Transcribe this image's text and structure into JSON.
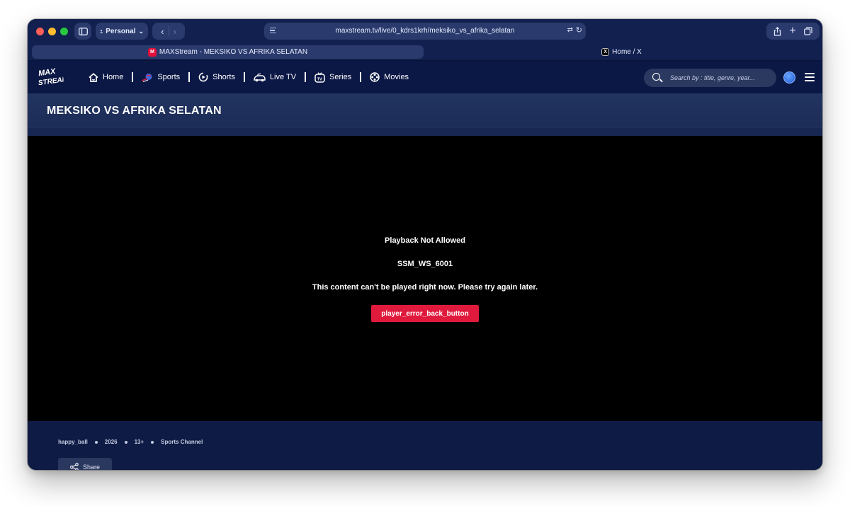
{
  "browser": {
    "profile_label": "Personal",
    "url": "maxstream.tv/live/0_kdrs1krh/meksiko_vs_afrika_selatan",
    "tabs": [
      {
        "title": "MAXStream - MEKSIKO VS AFRIKA SELATAN",
        "favicon": "maxstream-favicon",
        "active": true
      },
      {
        "title": "Home / X",
        "favicon": "x-favicon",
        "active": false
      }
    ]
  },
  "site": {
    "logo_text": "MAX STREAM",
    "nav": [
      {
        "label": "Home",
        "icon": "home-icon"
      },
      {
        "label": "Sports",
        "icon": "sports-icon"
      },
      {
        "label": "Shorts",
        "icon": "shorts-icon"
      },
      {
        "label": "Live TV",
        "icon": "live-tv-icon"
      },
      {
        "label": "Series",
        "icon": "series-icon"
      },
      {
        "label": "Movies",
        "icon": "movies-icon"
      }
    ],
    "search_placeholder": "Search by : title, genre, year...",
    "page_title": "MEKSIKO VS AFRIKA SELATAN"
  },
  "player": {
    "error_title": "Playback Not Allowed",
    "error_code": "SSM_WS_6001",
    "error_message": "This content can't be played right now. Please try again later.",
    "button_label": "player_error_back_button"
  },
  "info": {
    "meta": [
      "happy_ball",
      "2026",
      "13+",
      "Sports Channel"
    ],
    "share_label": "Share"
  },
  "colors": {
    "accent_red": "#e01a3c",
    "nav_bg": "#0b1845",
    "title_band": "#1f3060",
    "player_bg": "#000000"
  }
}
